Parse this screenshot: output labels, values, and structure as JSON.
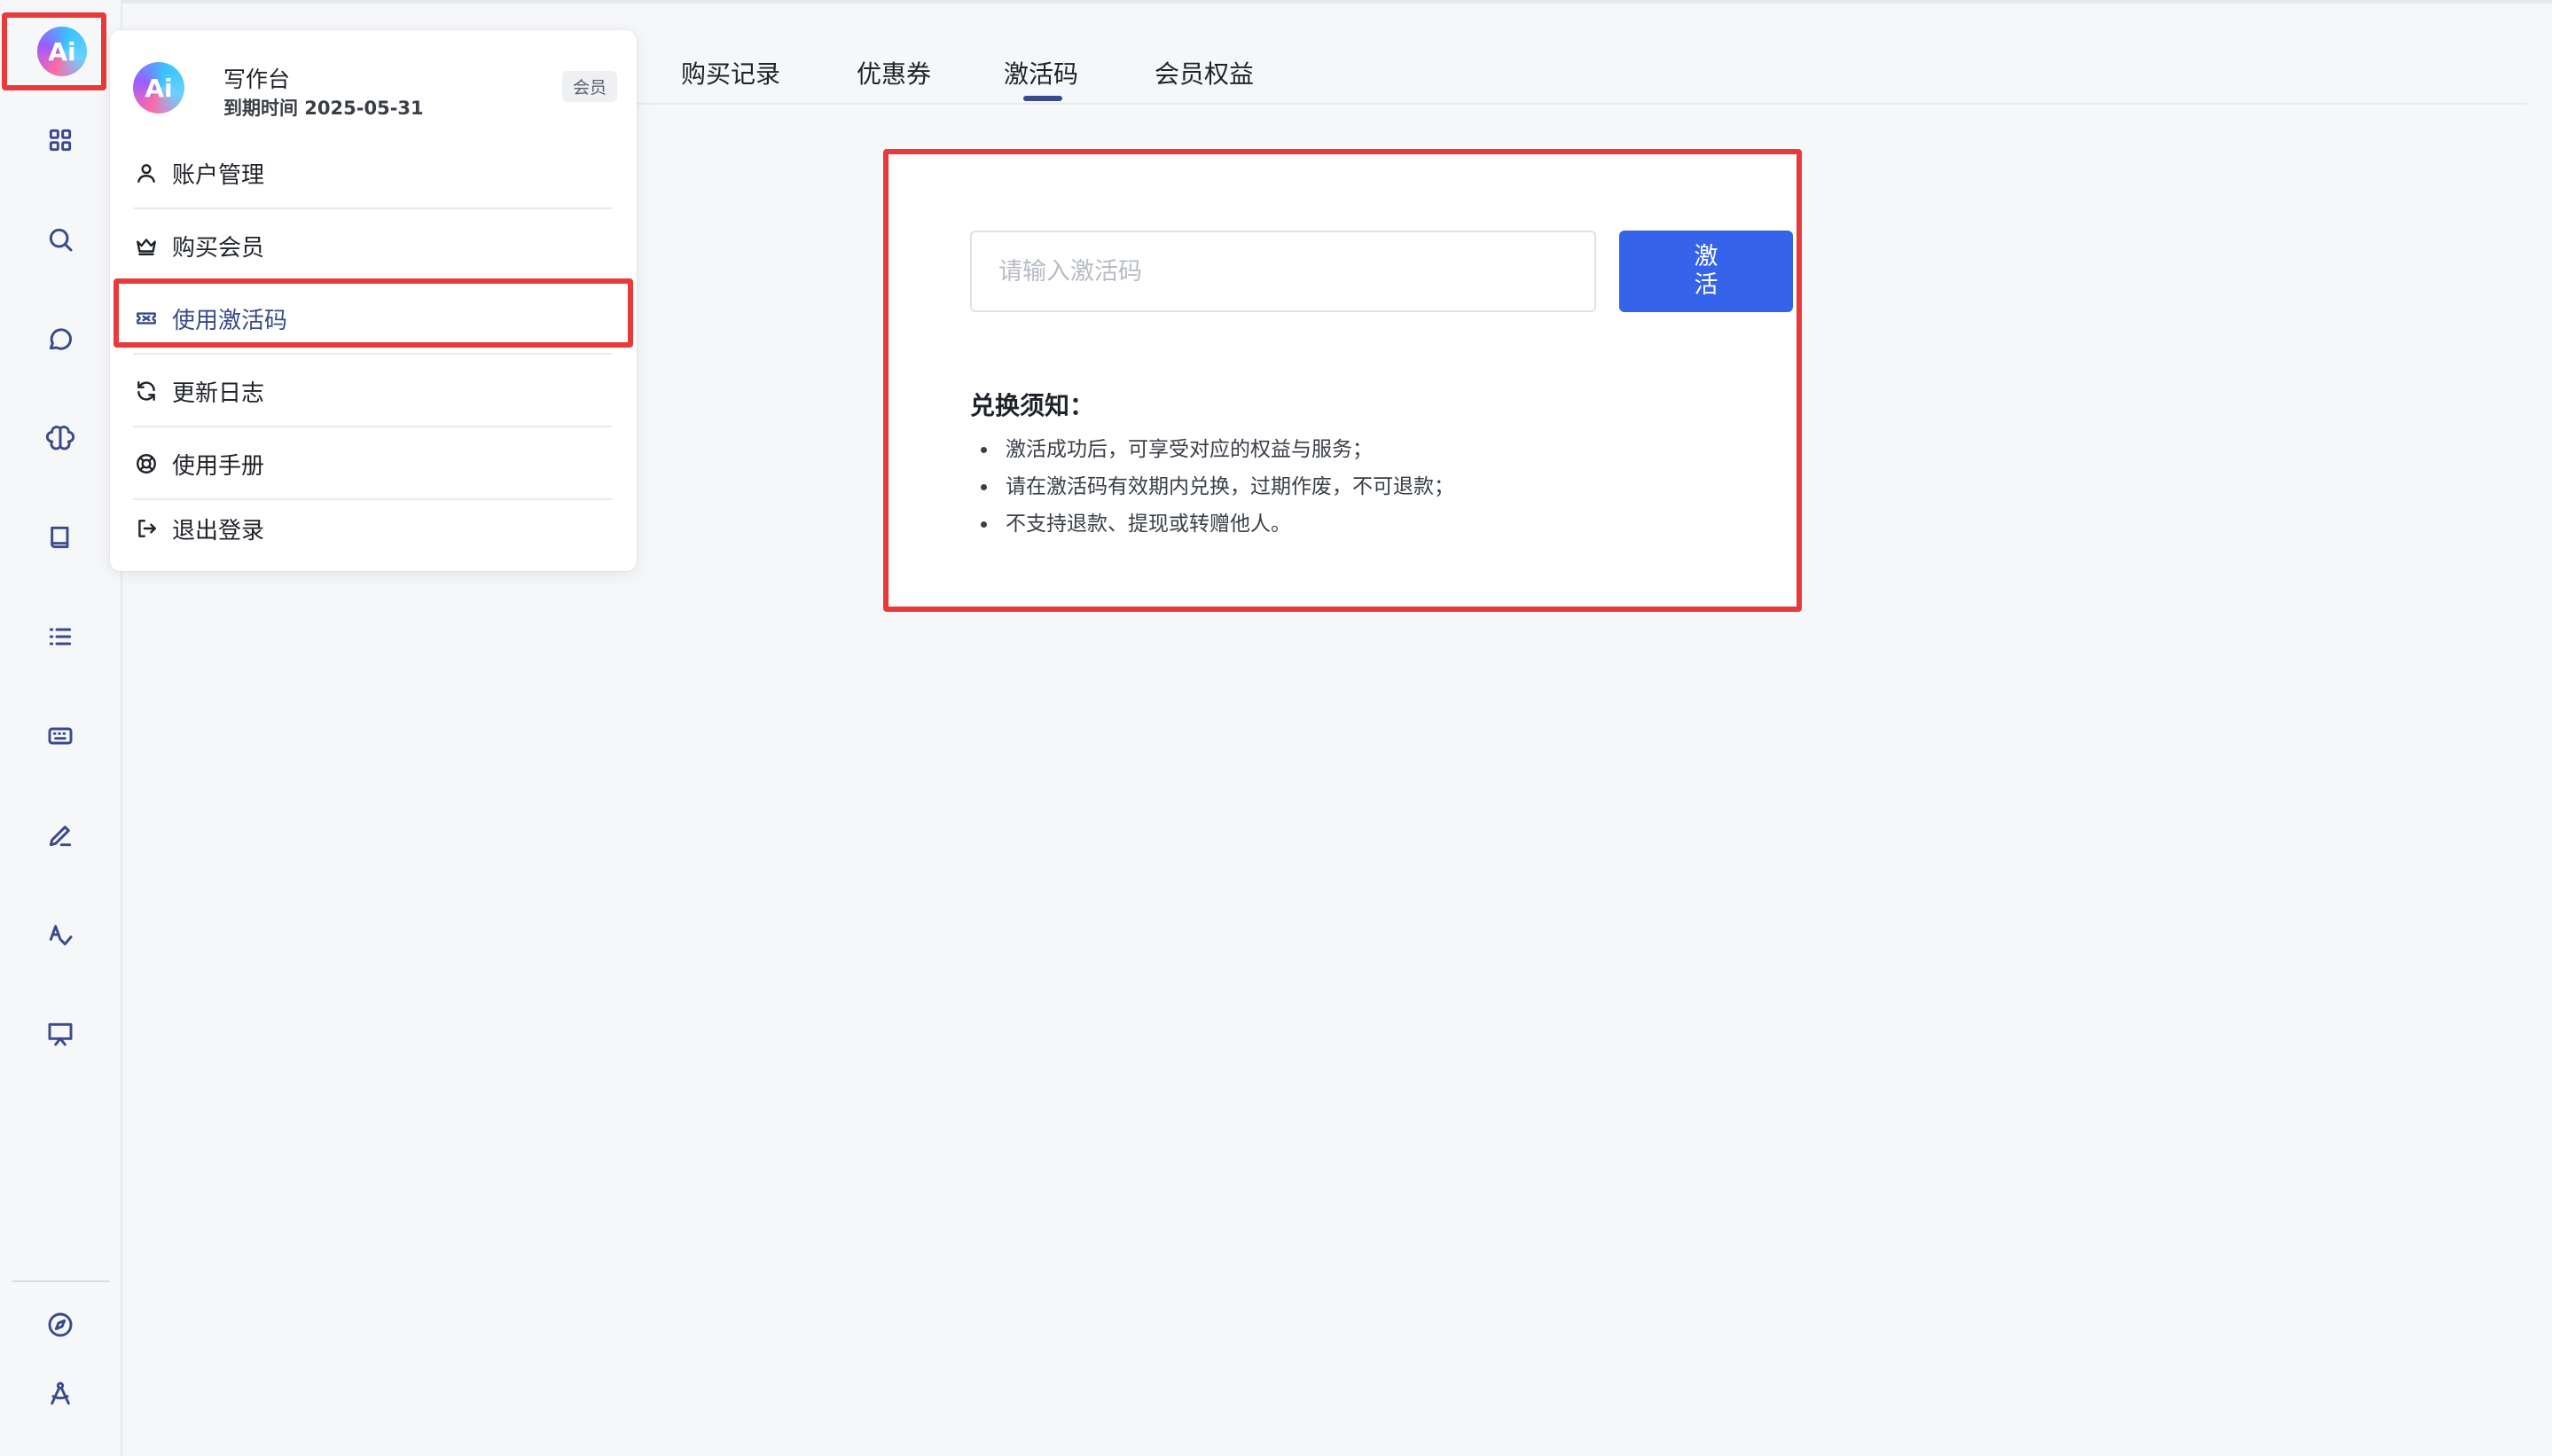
{
  "sidebar": {
    "logo_text": "Ai",
    "icons": [
      "grid-icon",
      "search-icon",
      "chat-icon",
      "brain-icon",
      "book-icon",
      "list-icon",
      "keyboard-icon",
      "pen-icon",
      "spellcheck-icon",
      "presentation-icon",
      "compass-icon",
      "compass-drafting-icon"
    ]
  },
  "menu": {
    "title": "写作台",
    "expire": "到期时间 2025-05-31",
    "badge": "会员",
    "items": [
      {
        "label": "账户管理",
        "icon": "user-icon"
      },
      {
        "label": "购买会员",
        "icon": "crown-icon"
      },
      {
        "label": "使用激活码",
        "icon": "ticket-icon"
      },
      {
        "label": "更新日志",
        "icon": "refresh-icon"
      },
      {
        "label": "使用手册",
        "icon": "lifebuoy-icon"
      },
      {
        "label": "退出登录",
        "icon": "logout-icon"
      }
    ]
  },
  "tabs": [
    {
      "label": "购买记录"
    },
    {
      "label": "优惠券"
    },
    {
      "label": "激活码"
    },
    {
      "label": "会员权益"
    }
  ],
  "activation": {
    "placeholder": "请输入激活码",
    "value": "",
    "button": "激活",
    "notice_title": "兑换须知：",
    "notices": [
      "激活成功后，可享受对应的权益与服务；",
      "请在激活码有效期内兑换，过期作废，不可退款；",
      "不支持退款、提现或转赠他人。"
    ]
  },
  "colors": {
    "accent": "#3563e9",
    "highlight": "#e83a3a",
    "icon": "#3a4a8a"
  }
}
